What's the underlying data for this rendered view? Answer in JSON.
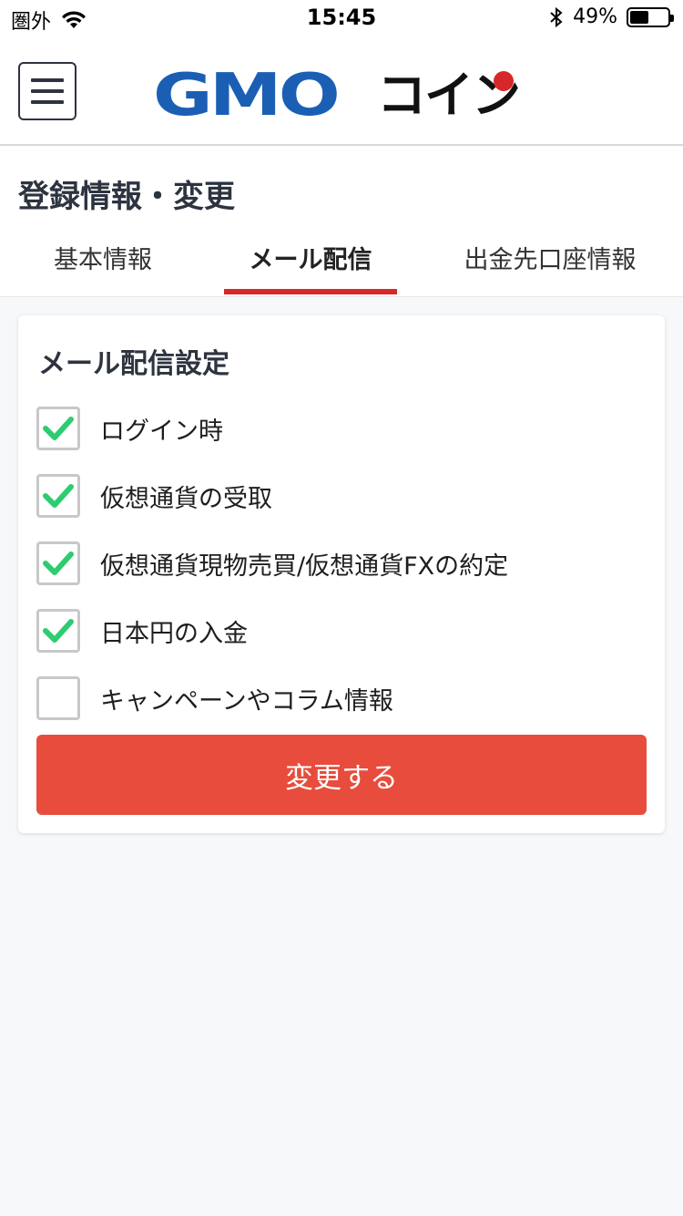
{
  "status_bar": {
    "carrier": "圏外",
    "time": "15:45",
    "battery_text": "49%",
    "battery_level": 0.49
  },
  "header": {
    "logo_text_gmo": "GMO",
    "logo_text_coin": "コイン",
    "colors": {
      "gmo_blue": "#1b5fb5",
      "dot_red": "#d62828"
    }
  },
  "page": {
    "title": "登録情報・変更",
    "tabs": [
      {
        "label": "基本情報",
        "active": false
      },
      {
        "label": "メール配信",
        "active": true
      },
      {
        "label": "出金先口座情報",
        "active": false
      }
    ]
  },
  "settings": {
    "title": "メール配信設定",
    "options": [
      {
        "label": "ログイン時",
        "checked": true
      },
      {
        "label": "仮想通貨の受取",
        "checked": true
      },
      {
        "label": "仮想通貨現物売買/仮想通貨FXの約定",
        "checked": true
      },
      {
        "label": "日本円の入金",
        "checked": true
      },
      {
        "label": "キャンペーンやコラム情報",
        "checked": false
      }
    ],
    "submit_label": "変更する",
    "colors": {
      "check_green": "#2ecc71",
      "button_red": "#e74c3c",
      "tab_red": "#d62828"
    }
  }
}
